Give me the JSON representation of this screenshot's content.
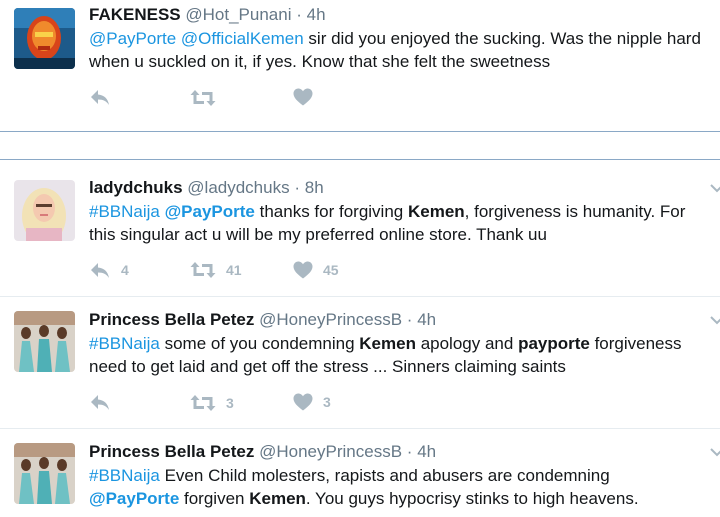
{
  "tweets": [
    {
      "name": "FAKENESS",
      "handle": "@Hot_Punani",
      "time": "4h",
      "line1": [
        {
          "t": "@PayPorte",
          "s": "link"
        },
        {
          "t": " ",
          "s": ""
        },
        {
          "t": "@OfficialKemen",
          "s": "link"
        },
        {
          "t": " sir did you enjoyed the sucking. Was the nipple hard",
          "s": ""
        }
      ],
      "line2": [
        {
          "t": "when u suckled on it, if yes. Know that she felt the sweetness",
          "s": ""
        }
      ],
      "reply_count": "",
      "retweet_count": "",
      "like_count": ""
    },
    {
      "name": "ladydchuks",
      "handle": "@ladydchuks",
      "time": "8h",
      "line1": [
        {
          "t": "#BBNaija",
          "s": "link"
        },
        {
          "t": " ",
          "s": ""
        },
        {
          "t": "@PayPorte",
          "s": "link b"
        },
        {
          "t": " thanks for forgiving ",
          "s": ""
        },
        {
          "t": "Kemen",
          "s": "b"
        },
        {
          "t": ", forgiveness is humanity. For",
          "s": ""
        }
      ],
      "line2": [
        {
          "t": "this singular act u will be my preferred online store. Thank uu",
          "s": ""
        }
      ],
      "reply_count": "4",
      "retweet_count": "41",
      "like_count": "45"
    },
    {
      "name": "Princess Bella Petez",
      "handle": "@HoneyPrincessB",
      "time": "4h",
      "line1": [
        {
          "t": "#BBNaija",
          "s": "link"
        },
        {
          "t": " some of you condemning ",
          "s": ""
        },
        {
          "t": "Kemen",
          "s": "b"
        },
        {
          "t": " apology and ",
          "s": ""
        },
        {
          "t": "payporte",
          "s": "b"
        },
        {
          "t": " forgiveness",
          "s": ""
        }
      ],
      "line2": [
        {
          "t": "need to get laid and get off the stress ... Sinners claiming saints",
          "s": ""
        }
      ],
      "reply_count": "",
      "retweet_count": "3",
      "like_count": "3"
    },
    {
      "name": "Princess Bella Petez",
      "handle": "@HoneyPrincessB",
      "time": "4h",
      "line1": [
        {
          "t": "#BBNaija",
          "s": "link"
        },
        {
          "t": " Even Child molesters, rapists and abusers are condemning",
          "s": ""
        }
      ],
      "line2": [
        {
          "t": "@PayPorte",
          "s": "link b"
        },
        {
          "t": " forgiven ",
          "s": ""
        },
        {
          "t": "Kemen",
          "s": "b"
        },
        {
          "t": ". You guys hypocrisy stinks to high heavens.",
          "s": ""
        }
      ],
      "reply_count": "",
      "retweet_count": "",
      "like_count": ""
    }
  ],
  "separator": "·",
  "colors": {
    "link": "#1b95e0",
    "muted": "#657786",
    "action": "#aab8c2",
    "divider": "#e6ecf0",
    "blue_rule": "#8aa8c6"
  }
}
